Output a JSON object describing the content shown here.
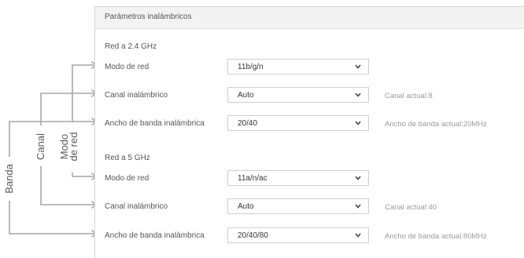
{
  "panel": {
    "title": "Parámetros inalámbricos"
  },
  "band24": {
    "heading": "Red a 2.4 GHz",
    "rows": [
      {
        "label": "Modo de red",
        "value": "11b/g/n",
        "note": ""
      },
      {
        "label": "Canal inalámbrico",
        "value": "Auto",
        "note": "Canal actual:8"
      },
      {
        "label": "Ancho de banda inalámbrica",
        "value": "20/40",
        "note": "Ancho de banda actual:20MHz"
      }
    ]
  },
  "band5": {
    "heading": "Red a 5 GHz",
    "rows": [
      {
        "label": "Modo de red",
        "value": "11a/n/ac",
        "note": ""
      },
      {
        "label": "Canal inalámbrico",
        "value": "Auto",
        "note": "Canal actual:40"
      },
      {
        "label": "Ancho de banda inalámbrica",
        "value": "20/40/80",
        "note": "Ancho de banda actual:80MHz"
      }
    ]
  },
  "annotations": {
    "banda": "Banda",
    "canal": "Canal",
    "modo": "Modo",
    "de_red": "de red"
  },
  "colors": {
    "line": "#9a9a9a",
    "chevron": "#444444"
  }
}
